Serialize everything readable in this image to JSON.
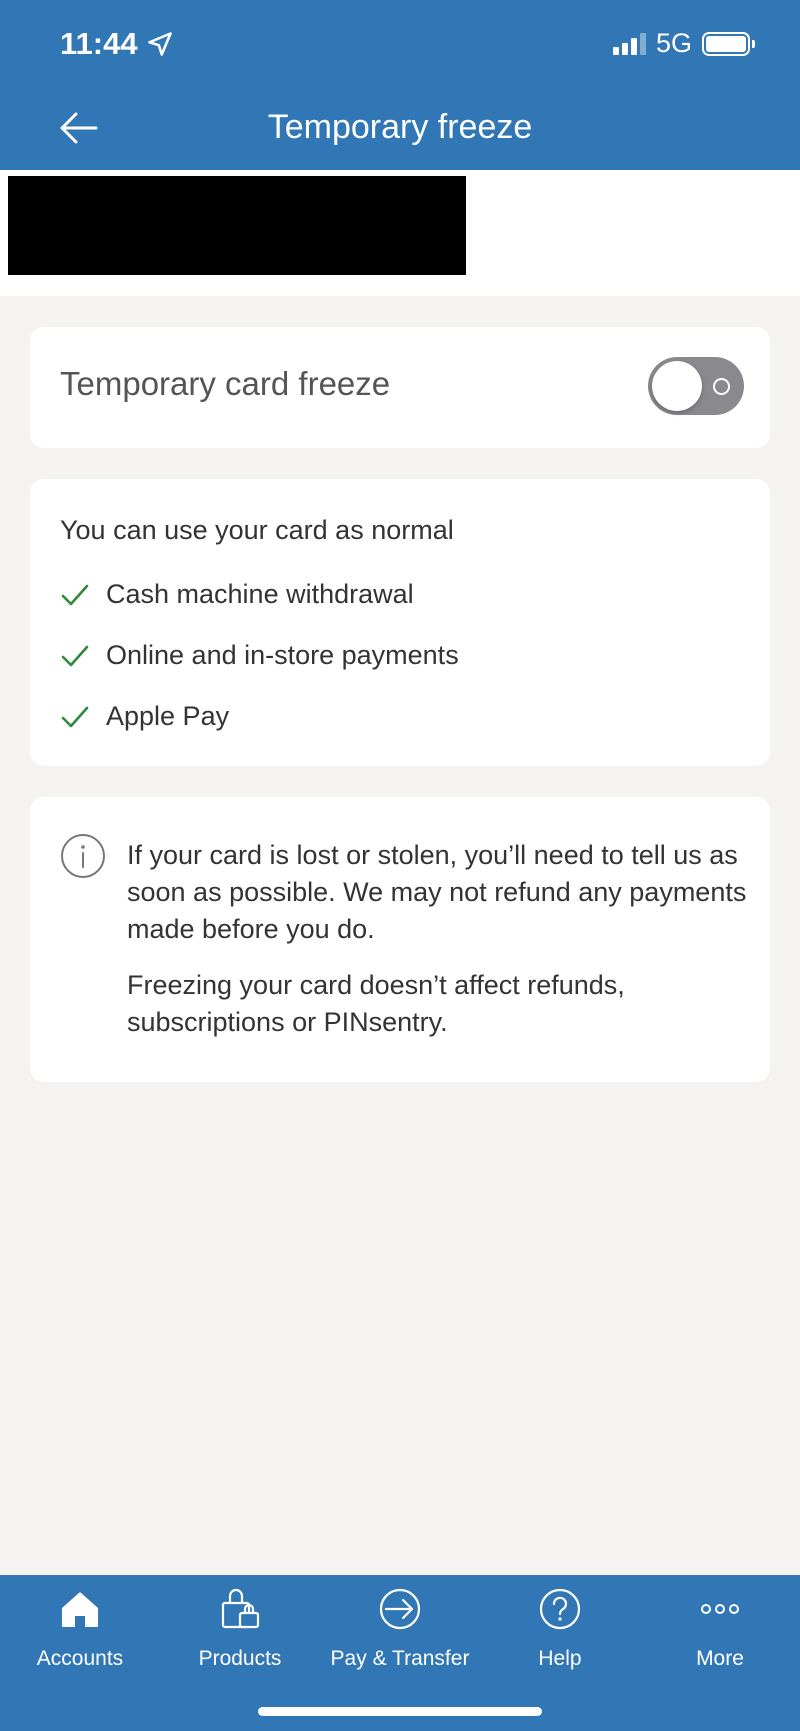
{
  "status_bar": {
    "time": "11:44",
    "network": "5G"
  },
  "header": {
    "title": "Temporary freeze",
    "back_icon": "arrow-left-icon"
  },
  "freeze_setting": {
    "label": "Temporary card freeze",
    "enabled": false
  },
  "card_usage": {
    "heading": "You can use your card as normal",
    "items": [
      "Cash machine withdrawal",
      "Online and in-store payments",
      "Apple Pay"
    ],
    "check_color": "#2e8b3a"
  },
  "info": {
    "paragraph1": "If your card is lost or stolen, you’ll need to tell us as soon as possible. We may not refund any payments made before you do.",
    "paragraph2": "Freezing your card doesn’t affect refunds, subscriptions or PINsentry."
  },
  "tabs": [
    {
      "label": "Accounts",
      "icon": "home-icon",
      "active": true
    },
    {
      "label": "Products",
      "icon": "shopping-bag-icon",
      "active": false
    },
    {
      "label": "Pay & Transfer",
      "icon": "arrow-circle-icon",
      "active": false
    },
    {
      "label": "Help",
      "icon": "question-circle-icon",
      "active": false
    },
    {
      "label": "More",
      "icon": "more-dots-icon",
      "active": false
    }
  ],
  "colors": {
    "brand": "#3176b5",
    "background": "#f4f3f2",
    "toggle_off": "#8a8a8e"
  }
}
